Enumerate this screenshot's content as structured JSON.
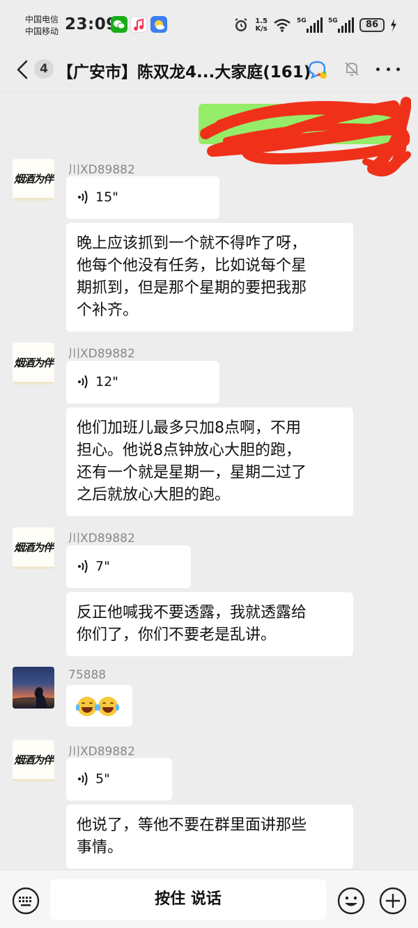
{
  "status_bar": {
    "carrier1": "中国电信",
    "carrier2": "中国移动",
    "time": "23:09",
    "net_speed_value": "1.5",
    "net_speed_unit": "K/s",
    "sim1_label": "5G",
    "sim2_label": "5G",
    "battery": "86",
    "app_icons": [
      "wechat-icon",
      "music-icon",
      "weather-icon"
    ]
  },
  "header": {
    "unread_count": "4",
    "title": "【广安市】陈双龙4...大家庭(161)"
  },
  "messages": [
    {
      "type": "own",
      "note": ""
    },
    {
      "sender": "川XD89882",
      "avatar_text": "烟酒为伴",
      "kind": "voice",
      "duration": "15\""
    },
    {
      "sender": "",
      "kind": "text",
      "lines": [
        "晚上应该抓到一个就不得咋了呀，",
        "他每个他没有任务，比如说每个星",
        "期抓到，但是那个星期的要把我那",
        "个补齐。"
      ]
    },
    {
      "sender": "川XD89882",
      "avatar_text": "烟酒为伴",
      "kind": "voice",
      "duration": "12\""
    },
    {
      "sender": "",
      "kind": "text",
      "lines": [
        "他们加班儿最多只加8点啊，不用",
        "担心。他说8点钟放心大胆的跑，",
        "还有一个就是星期一，星期二过了",
        "之后就放心大胆的跑。"
      ]
    },
    {
      "sender": "川XD89882",
      "avatar_text": "烟酒为伴",
      "kind": "voice",
      "duration": "7\""
    },
    {
      "sender": "",
      "kind": "text",
      "lines": [
        "反正他喊我不要透露，我就透露给",
        "你们了，你们不要老是乱讲。"
      ]
    },
    {
      "sender": "75888",
      "kind": "emoji",
      "emoji_count": 2
    },
    {
      "sender": "川XD89882",
      "avatar_text": "烟酒为伴",
      "kind": "voice",
      "duration": "5\""
    },
    {
      "sender": "",
      "kind": "text",
      "lines": [
        "他说了，等他不要在群里面讲那些",
        "事情。"
      ]
    }
  ],
  "input_bar": {
    "hold_to_talk": "按住 说话"
  },
  "colors": {
    "background": "#ededed",
    "own_bubble": "#95ec69",
    "redaction": "#f0311a"
  }
}
